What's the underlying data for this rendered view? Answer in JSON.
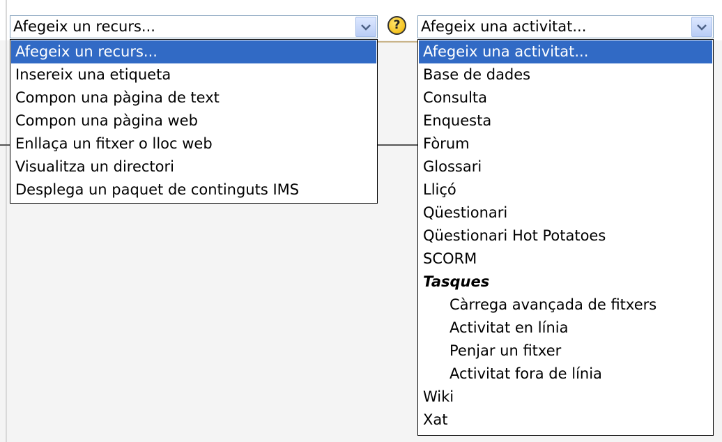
{
  "resource_select": {
    "value": "Afegeix un recurs...",
    "options": [
      "Afegeix un recurs...",
      "Insereix una etiqueta",
      "Compon una pàgina de text",
      "Compon una pàgina web",
      "Enllaça un fitxer o lloc web",
      "Visualitza un directori",
      "Desplega un paquet de continguts IMS"
    ],
    "selected_index": 0
  },
  "help_icon": {
    "glyph": "?",
    "icon": "help-icon"
  },
  "activity_select": {
    "value": "Afegeix una activitat...",
    "options": [
      {
        "label": "Afegeix una activitat...",
        "kind": "option"
      },
      {
        "label": "Base de dades",
        "kind": "option"
      },
      {
        "label": "Consulta",
        "kind": "option"
      },
      {
        "label": "Enquesta",
        "kind": "option"
      },
      {
        "label": "Fòrum",
        "kind": "option"
      },
      {
        "label": "Glossari",
        "kind": "option"
      },
      {
        "label": "Lliçó",
        "kind": "option"
      },
      {
        "label": "Qüestionari",
        "kind": "option"
      },
      {
        "label": "Qüestionari Hot Potatoes",
        "kind": "option"
      },
      {
        "label": "SCORM",
        "kind": "option"
      },
      {
        "label": "Tasques",
        "kind": "group"
      },
      {
        "label": "Càrrega avançada de fitxers",
        "kind": "sub"
      },
      {
        "label": "Activitat en línia",
        "kind": "sub"
      },
      {
        "label": "Penjar un fitxer",
        "kind": "sub"
      },
      {
        "label": "Activitat fora de línia",
        "kind": "sub"
      },
      {
        "label": "Wiki",
        "kind": "option"
      },
      {
        "label": "Xat",
        "kind": "option"
      }
    ],
    "selected_index": 0
  },
  "colors": {
    "selection": "#316ac5",
    "select_border": "#7f9db9",
    "help_icon": "#f0b400"
  }
}
